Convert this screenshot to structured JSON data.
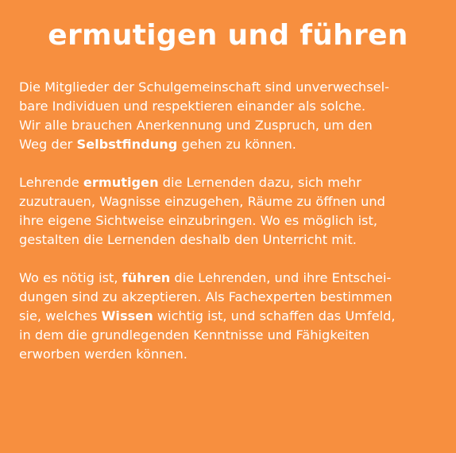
{
  "title": "ermutigen und führen",
  "background_color": "#F78F3F",
  "paragraphs": [
    [
      [
        {
          "t": "Die Mitglieder der Schulgemeinschaft sind unverwechsel-"
        }
      ],
      [
        {
          "t": "bare Individuen und respektieren einander als solche."
        }
      ],
      [
        {
          "t": "Wir alle brauchen Anerkennung und Zuspruch, um den"
        }
      ],
      [
        {
          "t": "Weg der "
        },
        {
          "t": "Selbstfindung",
          "b": true
        },
        {
          "t": " gehen zu können."
        }
      ]
    ],
    [
      [
        {
          "t": "Lehrende "
        },
        {
          "t": "ermutigen",
          "b": true
        },
        {
          "t": " die Lernenden dazu, sich mehr"
        }
      ],
      [
        {
          "t": "zuzutrauen, Wagnisse einzugehen, Räume zu öffnen und"
        }
      ],
      [
        {
          "t": "ihre eigene Sichtweise einzubringen. Wo es möglich ist,"
        }
      ],
      [
        {
          "t": "gestalten die Lernenden deshalb den Unterricht mit."
        }
      ]
    ],
    [
      [
        {
          "t": "Wo es nötig ist, "
        },
        {
          "t": "führen",
          "b": true
        },
        {
          "t": " die Lehrenden, und ihre Entschei-"
        }
      ],
      [
        {
          "t": "dungen sind zu akzeptieren. Als Fachexperten bestimmen"
        }
      ],
      [
        {
          "t": "sie, welches "
        },
        {
          "t": "Wissen",
          "b": true
        },
        {
          "t": " wichtig ist, und schaffen das Umfeld,"
        }
      ],
      [
        {
          "t": "in dem die grundlegenden Kenntnisse und Fähigkeiten"
        }
      ],
      [
        {
          "t": "erworben werden können."
        }
      ]
    ]
  ]
}
